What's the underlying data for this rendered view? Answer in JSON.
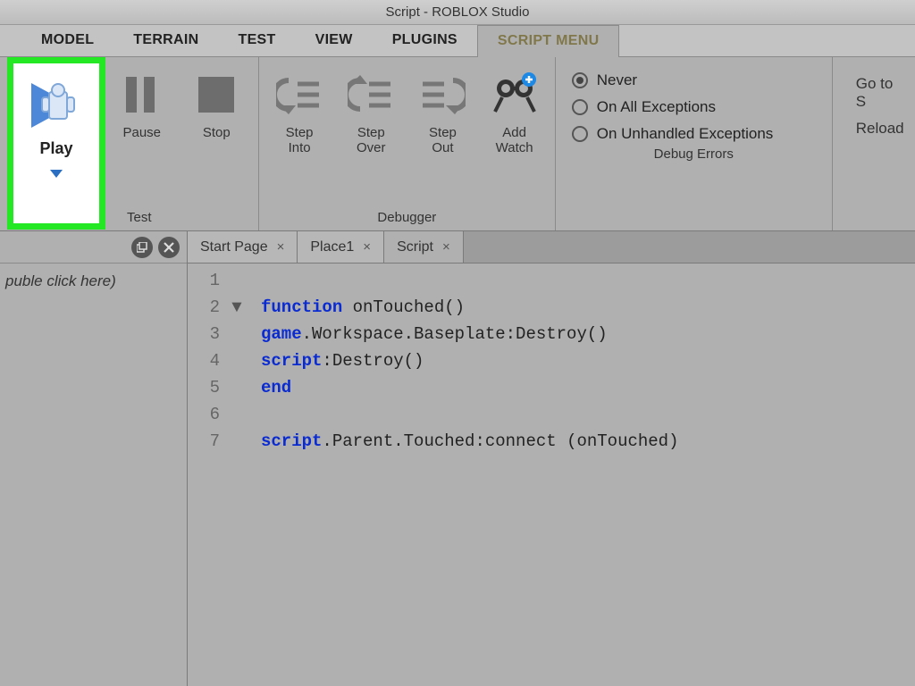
{
  "title": "Script - ROBLOX Studio",
  "menuTabs": {
    "model": "MODEL",
    "terrain": "TERRAIN",
    "test": "TEST",
    "view": "VIEW",
    "plugins": "PLUGINS",
    "scriptmenu": "SCRIPT MENU"
  },
  "ribbon": {
    "test": {
      "play": "Play",
      "pause": "Pause",
      "stop": "Stop",
      "label": "Test"
    },
    "debugger": {
      "stepInto": "Step\nInto",
      "stepOver": "Step\nOver",
      "stepOut": "Step\nOut",
      "addWatch": "Add\nWatch",
      "label": "Debugger"
    },
    "debugErrors": {
      "never": "Never",
      "onAll": "On All Exceptions",
      "onUnhandled": "On Unhandled Exceptions",
      "label": "Debug Errors"
    },
    "right": {
      "goto": "Go to S",
      "reload": "Reload"
    }
  },
  "leftPane": {
    "hint": "puble click here)"
  },
  "editorTabs": {
    "start": "Start Page",
    "place1": "Place1",
    "script": "Script"
  },
  "code": {
    "lineNums": [
      "1",
      "2",
      "3",
      "4",
      "5",
      "6",
      "7"
    ],
    "l2_kw": "function",
    "l2_rest": " onTouched()",
    "l3_kw": "game",
    "l3_rest": ".Workspace.Baseplate:Destroy()",
    "l4_kw": "script",
    "l4_rest": ":Destroy()",
    "l5_kw": "end",
    "l7_kw": "script",
    "l7_rest": ".Parent.Touched:connect (onTouched)"
  }
}
